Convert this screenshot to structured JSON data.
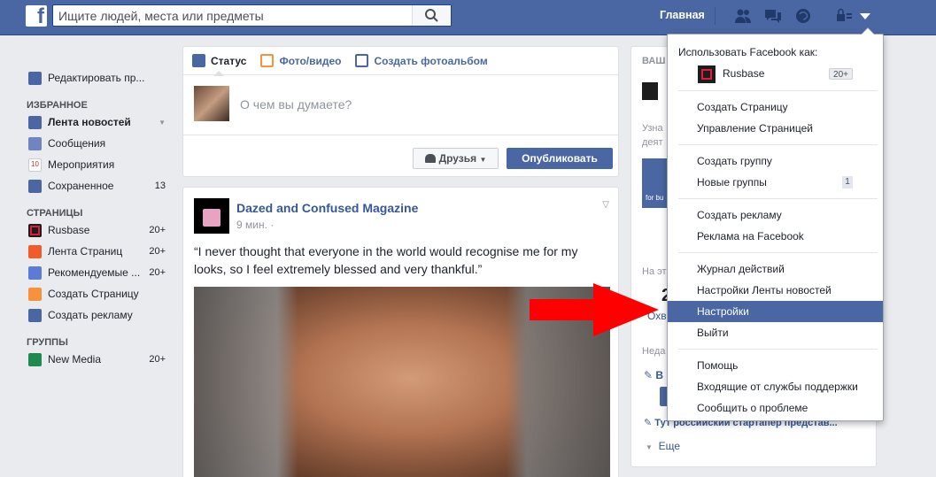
{
  "topbar": {
    "logo": "f",
    "search_placeholder": "Ищите людей, места или предметы",
    "home": "Главная",
    "icons": [
      "friends-icon",
      "messages-icon",
      "notifications-icon",
      "privacy-icon",
      "account-menu-icon"
    ]
  },
  "left": {
    "profile_edit": "Редактировать пр...",
    "favorites_header": "ИЗБРАННОЕ",
    "favorites": [
      {
        "label": "Лента новостей",
        "count": ""
      },
      {
        "label": "Сообщения",
        "count": ""
      },
      {
        "label": "Мероприятия",
        "count": ""
      },
      {
        "label": "Сохраненное",
        "count": "13"
      }
    ],
    "pages_header": "СТРАНИЦЫ",
    "pages": [
      {
        "label": "Rusbase",
        "count": "20+"
      },
      {
        "label": "Лента Страниц",
        "count": "20+"
      },
      {
        "label": "Рекомендуемые ...",
        "count": "20+"
      },
      {
        "label": "Создать Страницу",
        "count": ""
      },
      {
        "label": "Создать рекламу",
        "count": ""
      }
    ],
    "groups_header": "ГРУППЫ",
    "groups": [
      {
        "label": "New Media",
        "count": "20+"
      }
    ],
    "event_day": "10"
  },
  "composer": {
    "tab_status": "Статус",
    "tab_photo": "Фото/видео",
    "tab_album": "Создать фотоальбом",
    "placeholder": "О чем вы думаете?",
    "audience": "Друзья",
    "publish": "Опубликовать"
  },
  "post": {
    "author": "Dazed and Confused Magazine",
    "time": "9 мин. ·",
    "text": "“I never thought that everyone in the world would recognise me for my looks, so I feel extremely blessed and very thankful.”"
  },
  "right": {
    "header_partial": "ВАШ",
    "learn_partial": "Узна",
    "activity_partial": "деят",
    "for_bus": "for bu",
    "this_week": "На эт",
    "big_number": "2",
    "reach": "Охв",
    "week": "Неда",
    "v_partial": "В",
    "startup_line": "Тут российский стартапер представ...",
    "more": "Еще"
  },
  "dropdown": {
    "use_as": "Использовать Facebook как:",
    "page_name": "Rusbase",
    "page_badge": "20+",
    "group1": [
      "Создать Страницу",
      "Управление Страницей"
    ],
    "group2": [
      "Создать группу",
      "Новые группы"
    ],
    "new_groups_badge": "1",
    "group3": [
      "Создать рекламу",
      "Реклама на Facebook"
    ],
    "group4": [
      "Журнал действий",
      "Настройки Ленты новостей",
      "Настройки",
      "Выйти"
    ],
    "group5": [
      "Помощь",
      "Входящие от службы поддержки",
      "Сообщить о проблеме"
    ],
    "highlight": "Настройки"
  },
  "colors": {
    "brand": "#4b67a3",
    "arrow": "#ff0000",
    "link": "#365899"
  }
}
